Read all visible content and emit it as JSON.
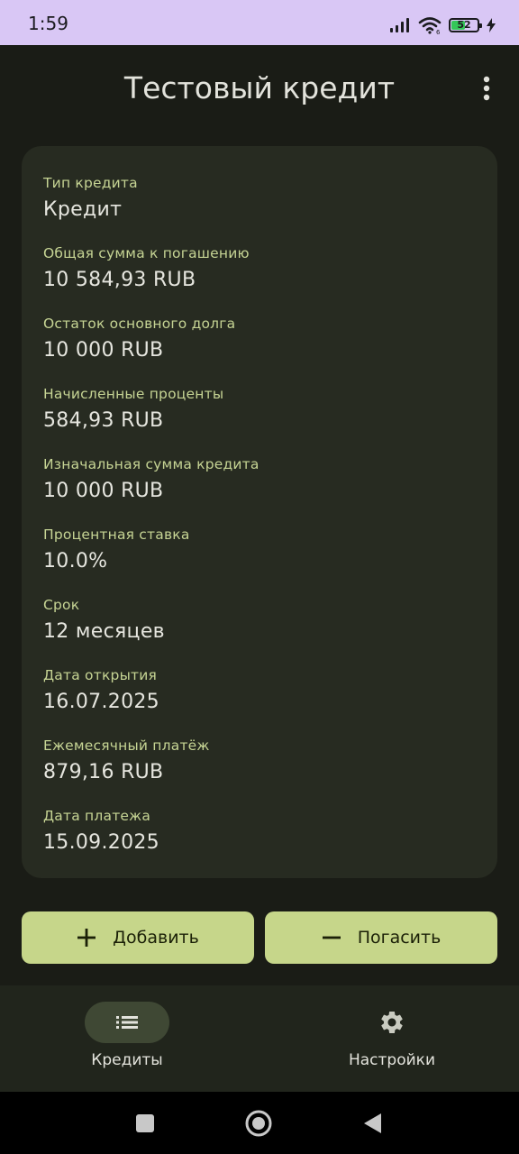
{
  "status_bar": {
    "time": "1:59",
    "battery_level": "52",
    "battery_percent": 52,
    "icons": [
      "signal-icon",
      "wifi-icon",
      "battery-icon",
      "charging-icon"
    ]
  },
  "header": {
    "title": "Тестовый кредит",
    "menu_icon": "more-vert-icon"
  },
  "details": [
    {
      "label": "Тип кредита",
      "value": "Кредит"
    },
    {
      "label": "Общая сумма к погашению",
      "value": "10 584,93 RUB"
    },
    {
      "label": "Остаток основного долга",
      "value": "10 000 RUB"
    },
    {
      "label": "Начисленные проценты",
      "value": "584,93 RUB"
    },
    {
      "label": "Изначальная сумма кредита",
      "value": "10 000 RUB"
    },
    {
      "label": "Процентная ставка",
      "value": "10.0%"
    },
    {
      "label": "Срок",
      "value": "12 месяцев"
    },
    {
      "label": "Дата открытия",
      "value": "16.07.2025"
    },
    {
      "label": "Ежемесячный платёж",
      "value": "879,16 RUB"
    },
    {
      "label": "Дата платежа",
      "value": "15.09.2025"
    }
  ],
  "actions": {
    "add_label": "Добавить",
    "add_icon": "plus-icon",
    "repay_label": "Погасить",
    "repay_icon": "minus-icon"
  },
  "bottom_nav": {
    "items": [
      {
        "label": "Кредиты",
        "icon": "list-icon",
        "selected": true
      },
      {
        "label": "Настройки",
        "icon": "gear-icon",
        "selected": false
      }
    ]
  },
  "colors": {
    "background": "#1a1c16",
    "card": "#272b21",
    "label": "#c6d494",
    "accent_button": "#c6d68a",
    "status_bar": "#d9c7f5"
  }
}
